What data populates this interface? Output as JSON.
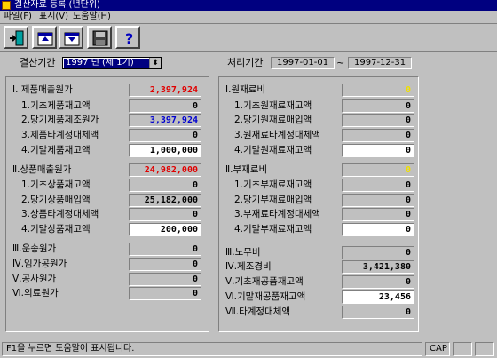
{
  "window": {
    "title": "결산자료 등록 (년단위)"
  },
  "menu": [
    "파일(F)",
    "표시(V)",
    "도움말(H)"
  ],
  "toolbar": {
    "buttons": [
      {
        "icon": "exit-door-icon"
      },
      {
        "icon": "calendar-up-icon"
      },
      {
        "icon": "calendar-down-icon"
      },
      {
        "icon": "save-disk-icon"
      },
      {
        "icon": "help-question-icon"
      }
    ]
  },
  "period": {
    "label": "결산기간",
    "selected": "1997 년 (제 1기)",
    "dropdown_arrow": "⬍"
  },
  "processing": {
    "label": "처리기간",
    "start": "1997-01-01",
    "separator": "~",
    "end": "1997-12-31"
  },
  "left": {
    "rows": [
      {
        "label": "Ⅰ. 제품매출원가",
        "value": "2,397,924",
        "color": "red"
      },
      {
        "label": "1.기초제품재고액",
        "value": "0"
      },
      {
        "label": "2.당기제품제조원가",
        "value": "3,397,924",
        "color": "blue"
      },
      {
        "label": "3.제품타계정대체액",
        "value": "0"
      },
      {
        "label": "4.기말제품재고액",
        "value": "1,000,000",
        "white": true
      },
      {
        "label": "Ⅱ.상품매출원가",
        "value": "24,982,000",
        "color": "red"
      },
      {
        "label": "1.기초상품재고액",
        "value": "0"
      },
      {
        "label": "2.당기상품매입액",
        "value": "25,182,000"
      },
      {
        "label": "3.상품타계정대체액",
        "value": "0"
      },
      {
        "label": "4.기말상품재고액",
        "value": "200,000",
        "white": true
      },
      {
        "label": "Ⅲ.운송원가",
        "value": "0"
      },
      {
        "label": "Ⅳ.임가공원가",
        "value": "0"
      },
      {
        "label": "Ⅴ.공사원가",
        "value": "0"
      },
      {
        "label": "Ⅵ.의료원가",
        "value": "0"
      }
    ]
  },
  "right": {
    "rows": [
      {
        "label": "Ⅰ.원재료비",
        "value": "0",
        "color": "yellow"
      },
      {
        "label": "1.기초원재료재고액",
        "value": "0"
      },
      {
        "label": "2.당기원재료매입액",
        "value": "0"
      },
      {
        "label": "3.원재료타계정대체액",
        "value": "0"
      },
      {
        "label": "4.기말원재료재고액",
        "value": "0",
        "white": true
      },
      {
        "label": "Ⅱ.부재료비",
        "value": "0",
        "color": "yellow"
      },
      {
        "label": "1.기초부재료재고액",
        "value": "0"
      },
      {
        "label": "2.당기부재료매입액",
        "value": "0"
      },
      {
        "label": "3.부재료타계정대체액",
        "value": "0"
      },
      {
        "label": "4.기말부재료재고액",
        "value": "0",
        "white": true
      },
      {
        "label": "Ⅲ.노무비",
        "value": "0"
      },
      {
        "label": "Ⅳ.제조경비",
        "value": "3,421,380"
      },
      {
        "label": "Ⅴ.기초재공품재고액",
        "value": "0"
      },
      {
        "label": "Ⅵ.기말재공품재고액",
        "value": "23,456",
        "white": true
      },
      {
        "label": "Ⅶ.타계정대체액",
        "value": "0"
      }
    ]
  },
  "status": {
    "message": "F1을 누르면 도움말이 표시됩니다.",
    "caps": "CAP"
  }
}
